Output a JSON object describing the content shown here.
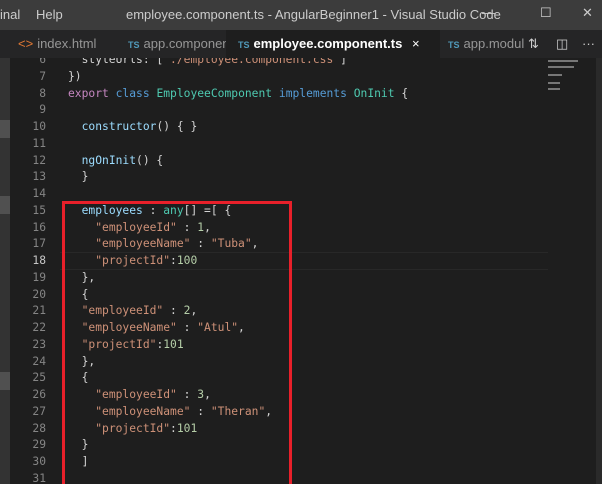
{
  "titlebar": {
    "menu": [
      "inal",
      "Help"
    ],
    "title": "employee.component.ts - AngularBeginner1 - Visual Studio Code",
    "minimize": "—",
    "maximize": "☐",
    "close": "✕"
  },
  "tabs": [
    {
      "icon": "<>",
      "label": "index.html",
      "type": "html"
    },
    {
      "icon": "TS",
      "label": "app.component.ts",
      "type": "ts"
    },
    {
      "icon": "TS",
      "label": "employee.component.ts",
      "type": "ts",
      "active": true,
      "close": "×"
    },
    {
      "icon": "TS",
      "label": "app.modul",
      "type": "ts"
    }
  ],
  "tab_actions": {
    "compare": "⇅",
    "split": "◫",
    "more": "···"
  },
  "colors": {
    "keyword": "#569cd6",
    "control": "#c586c0",
    "type": "#4ec9b0",
    "variable": "#9cdcfe",
    "string": "#ce9178",
    "number": "#b5cea8",
    "text": "#d4d4d4",
    "highlight_box": "#e8202a"
  },
  "editor": {
    "current_line": 18,
    "lines": [
      {
        "n": "6",
        "t": [
          [
            "text",
            "  styleUrls: ["
          ],
          [
            "string",
            "'./employee.component.css'"
          ],
          [
            "text",
            "]"
          ]
        ]
      },
      {
        "n": "7",
        "t": [
          [
            "text",
            "})"
          ]
        ]
      },
      {
        "n": "8",
        "t": [
          [
            "control",
            "export"
          ],
          [
            "text",
            " "
          ],
          [
            "keyword",
            "class"
          ],
          [
            "text",
            " "
          ],
          [
            "type",
            "EmployeeComponent"
          ],
          [
            "text",
            " "
          ],
          [
            "keyword",
            "implements"
          ],
          [
            "text",
            " "
          ],
          [
            "type",
            "OnInit"
          ],
          [
            "text",
            " {"
          ]
        ]
      },
      {
        "n": "9",
        "t": []
      },
      {
        "n": "10",
        "t": [
          [
            "text",
            "  "
          ],
          [
            "variable",
            "constructor"
          ],
          [
            "text",
            "() { }"
          ]
        ]
      },
      {
        "n": "11",
        "t": []
      },
      {
        "n": "12",
        "t": [
          [
            "text",
            "  "
          ],
          [
            "variable",
            "ngOnInit"
          ],
          [
            "text",
            "() {"
          ]
        ]
      },
      {
        "n": "13",
        "t": [
          [
            "text",
            "  }"
          ]
        ]
      },
      {
        "n": "14",
        "t": []
      },
      {
        "n": "15",
        "t": [
          [
            "text",
            "  "
          ],
          [
            "variable",
            "employees"
          ],
          [
            "text",
            " : "
          ],
          [
            "type",
            "any"
          ],
          [
            "text",
            "[] =[ {"
          ]
        ]
      },
      {
        "n": "16",
        "t": [
          [
            "text",
            "    "
          ],
          [
            "string",
            "\"employeeId\""
          ],
          [
            "text",
            " : "
          ],
          [
            "number",
            "1"
          ],
          [
            "text",
            ","
          ]
        ]
      },
      {
        "n": "17",
        "t": [
          [
            "text",
            "    "
          ],
          [
            "string",
            "\"employeeName\""
          ],
          [
            "text",
            " : "
          ],
          [
            "string",
            "\"Tuba\""
          ],
          [
            "text",
            ","
          ]
        ]
      },
      {
        "n": "18",
        "t": [
          [
            "text",
            "    "
          ],
          [
            "string",
            "\"projectId\""
          ],
          [
            "text",
            ":"
          ],
          [
            "number",
            "100"
          ]
        ]
      },
      {
        "n": "19",
        "t": [
          [
            "text",
            "  },"
          ]
        ]
      },
      {
        "n": "20",
        "t": [
          [
            "text",
            "  {"
          ]
        ]
      },
      {
        "n": "21",
        "t": [
          [
            "text",
            "  "
          ],
          [
            "string",
            "\"employeeId\""
          ],
          [
            "text",
            " : "
          ],
          [
            "number",
            "2"
          ],
          [
            "text",
            ","
          ]
        ]
      },
      {
        "n": "22",
        "t": [
          [
            "text",
            "  "
          ],
          [
            "string",
            "\"employeeName\""
          ],
          [
            "text",
            " : "
          ],
          [
            "string",
            "\"Atul\""
          ],
          [
            "text",
            ","
          ]
        ]
      },
      {
        "n": "23",
        "t": [
          [
            "text",
            "  "
          ],
          [
            "string",
            "\"projectId\""
          ],
          [
            "text",
            ":"
          ],
          [
            "number",
            "101"
          ]
        ]
      },
      {
        "n": "24",
        "t": [
          [
            "text",
            "  },"
          ]
        ]
      },
      {
        "n": "25",
        "t": [
          [
            "text",
            "  {"
          ]
        ]
      },
      {
        "n": "26",
        "t": [
          [
            "text",
            "    "
          ],
          [
            "string",
            "\"employeeId\""
          ],
          [
            "text",
            " : "
          ],
          [
            "number",
            "3"
          ],
          [
            "text",
            ","
          ]
        ]
      },
      {
        "n": "27",
        "t": [
          [
            "text",
            "    "
          ],
          [
            "string",
            "\"employeeName\""
          ],
          [
            "text",
            " : "
          ],
          [
            "string",
            "\"Theran\""
          ],
          [
            "text",
            ","
          ]
        ]
      },
      {
        "n": "28",
        "t": [
          [
            "text",
            "    "
          ],
          [
            "string",
            "\"projectId\""
          ],
          [
            "text",
            ":"
          ],
          [
            "number",
            "101"
          ]
        ]
      },
      {
        "n": "29",
        "t": [
          [
            "text",
            "  }"
          ]
        ]
      },
      {
        "n": "30",
        "t": [
          [
            "text",
            "  ]"
          ]
        ]
      },
      {
        "n": "31",
        "t": []
      }
    ]
  }
}
